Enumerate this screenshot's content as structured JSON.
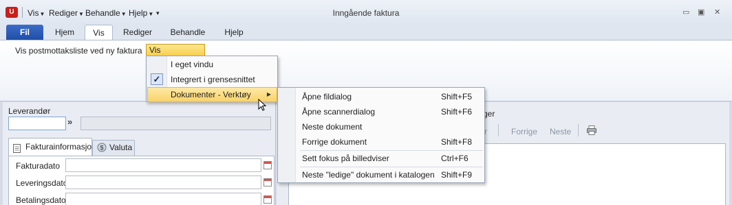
{
  "window": {
    "title": "Inngående faktura",
    "app_icon_text": "U",
    "quick_access": [
      {
        "label": "Vis"
      },
      {
        "label": "Rediger"
      },
      {
        "label": "Behandle"
      },
      {
        "label": "Hjelp"
      }
    ],
    "controls": {
      "minimize": "▭",
      "restore": "▣",
      "close": "✕"
    }
  },
  "ribbon": {
    "file_tab": "Fil",
    "tabs": [
      {
        "label": "Hjem"
      },
      {
        "label": "Vis",
        "active": true
      },
      {
        "label": "Rediger"
      },
      {
        "label": "Behandle"
      },
      {
        "label": "Hjelp"
      }
    ],
    "postmottak_label": "Vis postmottaksliste ved ny faktura",
    "vis_dokument_label": "Vis dokument"
  },
  "vis_dokument_menu": {
    "items": [
      {
        "label": "I eget vindu",
        "checked": false
      },
      {
        "label": "Integrert i grensesnittet",
        "checked": true
      },
      {
        "label": "Dokumenter - Verktøy",
        "has_submenu": true,
        "highlighted": true
      }
    ],
    "check_glyph": "✓"
  },
  "verktoy_submenu": {
    "items": [
      {
        "label": "Åpne fildialog",
        "shortcut": "Shift+F5"
      },
      {
        "label": "Åpne scannerdialog",
        "shortcut": "Shift+F6"
      },
      {
        "label": "Neste dokument",
        "shortcut": ""
      },
      {
        "label": "Forrige dokument",
        "shortcut": "Shift+F8"
      },
      {
        "label": "Sett fokus på billedviser",
        "shortcut": "Ctrl+F6"
      },
      {
        "label": "Neste \"ledige\" dokument i katalogen",
        "shortcut": "Shift+F9"
      }
    ]
  },
  "left_panel": {
    "leverandor_label": "Leverandør",
    "leverandor_value": "",
    "tabs": [
      {
        "label": "Fakturainformasjon",
        "active": true
      },
      {
        "label": "Valuta"
      }
    ],
    "fields": [
      {
        "label": "Fakturadato",
        "value": ""
      },
      {
        "label": "Leveringsdato",
        "value": ""
      },
      {
        "label": "Betalingsdato",
        "value": ""
      }
    ]
  },
  "right_panel": {
    "label_fragment": "ger",
    "toolbar": [
      {
        "label": "r"
      },
      {
        "label": "Forrige"
      },
      {
        "label": "Neste"
      }
    ]
  }
}
